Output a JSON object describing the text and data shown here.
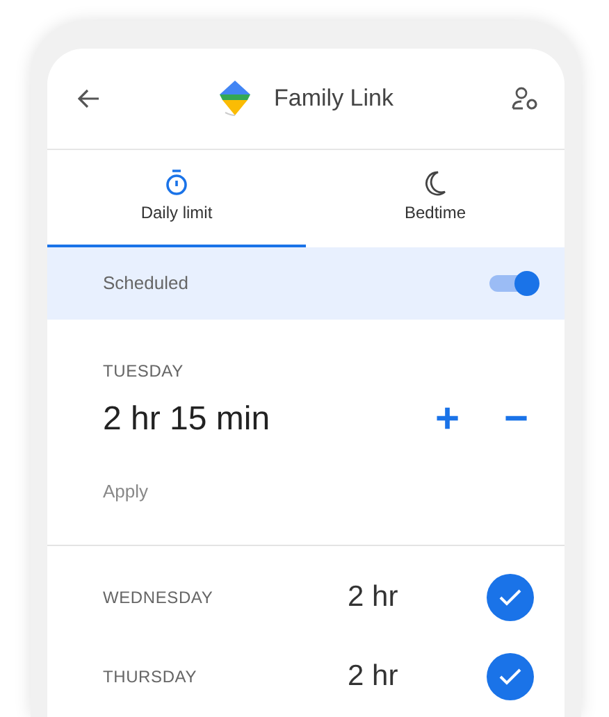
{
  "app_bar": {
    "title": "Family Link"
  },
  "tabs": [
    {
      "label": "Daily limit",
      "kind": "timer",
      "selected": true
    },
    {
      "label": "Bedtime",
      "kind": "moon",
      "selected": false
    }
  ],
  "schedule": {
    "label": "Scheduled",
    "on": true
  },
  "editing_day": {
    "day": "TUESDAY",
    "limit": "2 hr 15 min",
    "increase": "+",
    "decrease": "−",
    "apply": "Apply"
  },
  "days": [
    {
      "day": "WEDNESDAY",
      "limit": "2 hr",
      "checked": true
    },
    {
      "day": "THURSDAY",
      "limit": "2 hr",
      "checked": true
    }
  ]
}
